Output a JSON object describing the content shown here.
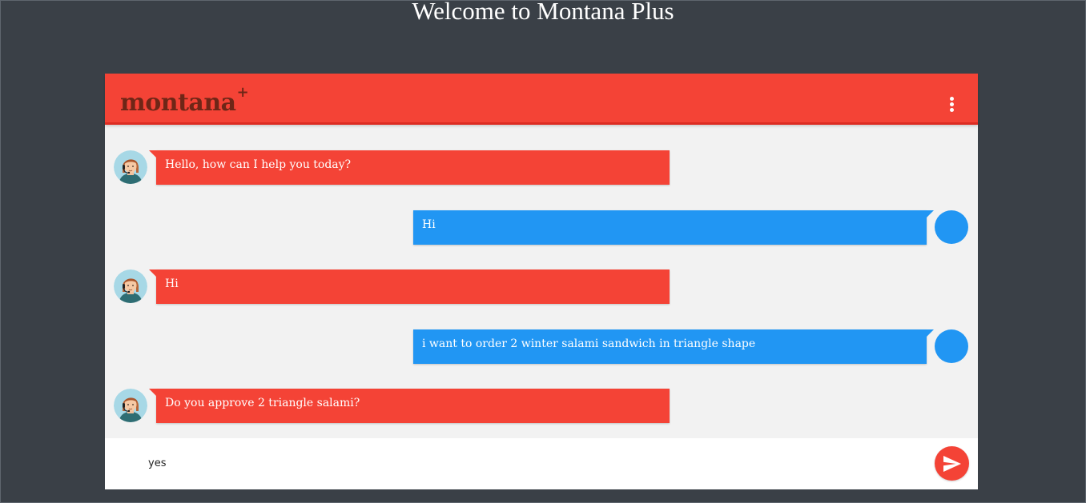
{
  "page": {
    "title": "Welcome to Montana Plus"
  },
  "header": {
    "logo_text": "montana",
    "logo_plus": "+",
    "menu_icon": "more-vert-icon"
  },
  "messages": [
    {
      "sender": "bot",
      "text": "Hello, how can I help you today?",
      "avatar": "support-agent-avatar"
    },
    {
      "sender": "user",
      "text": "Hi",
      "avatar": "user-avatar"
    },
    {
      "sender": "bot",
      "text": "Hi",
      "avatar": "support-agent-avatar"
    },
    {
      "sender": "user",
      "text": "i want to order 2 winter salami sandwich in triangle shape",
      "avatar": "user-avatar"
    },
    {
      "sender": "bot",
      "text": "Do you approve 2 triangle salami?",
      "avatar": "support-agent-avatar"
    }
  ],
  "input": {
    "value": "yes",
    "send_icon": "send-icon"
  },
  "colors": {
    "background": "#3a4047",
    "brand_red": "#f44336",
    "user_blue": "#2196f3",
    "chat_bg": "#f2f2f2"
  }
}
